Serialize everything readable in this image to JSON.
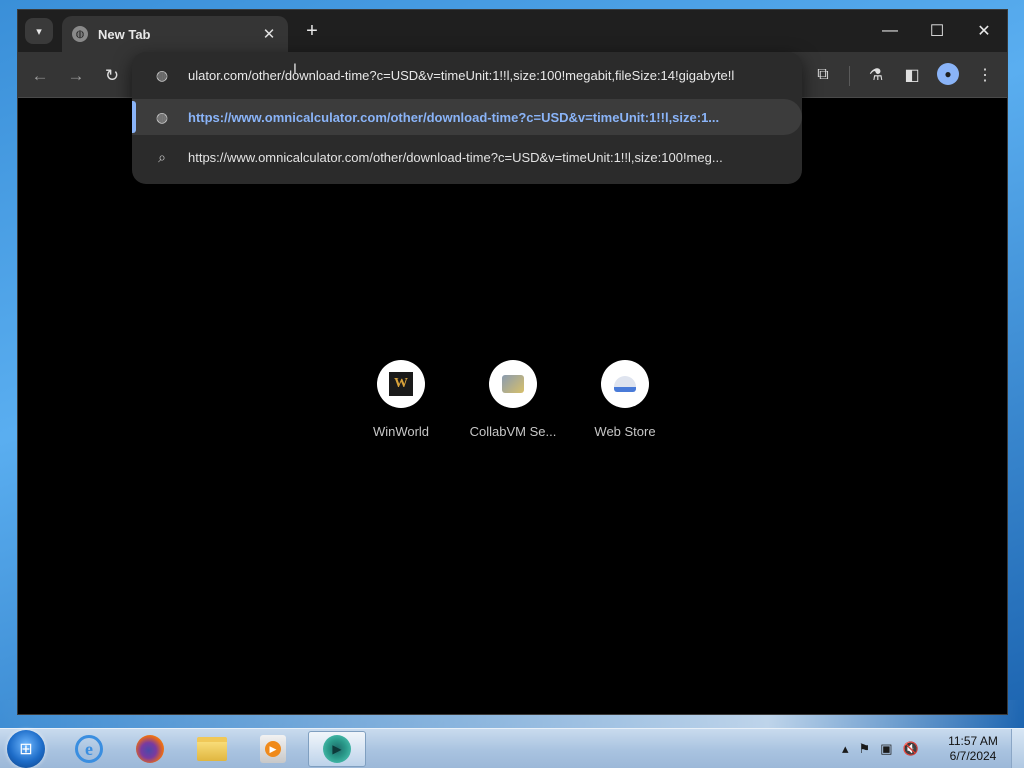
{
  "browser": {
    "tab": {
      "title": "New Tab"
    },
    "omnibox": {
      "input_text": "ulator.com/other/download-time?c=USD&v=timeUnit:1!!l,size:100!megabit,fileSize:14!gigabyte!l",
      "suggestions": [
        {
          "type": "url",
          "icon": "globe-icon",
          "text": "https://www.omnicalculator.com/other/download-time?c=USD&v=timeUnit:1!!l,size:1..."
        },
        {
          "type": "search",
          "icon": "search-icon",
          "text": "https://www.omnicalculator.com/other/download-time?c=USD&v=timeUnit:1!!l,size:100!meg..."
        }
      ]
    },
    "shortcuts": [
      {
        "label": "WinWorld",
        "icon": "winworld-icon"
      },
      {
        "label": "CollabVM Se...",
        "icon": "collabvm-icon"
      },
      {
        "label": "Web Store",
        "icon": "web-store-icon"
      }
    ]
  },
  "taskbar": {
    "clock": {
      "time": "11:57 AM",
      "date": "6/7/2024"
    }
  },
  "colors": {
    "accent": "#8ab4f8",
    "tab_bg": "#353535",
    "page_bg": "#000000"
  }
}
